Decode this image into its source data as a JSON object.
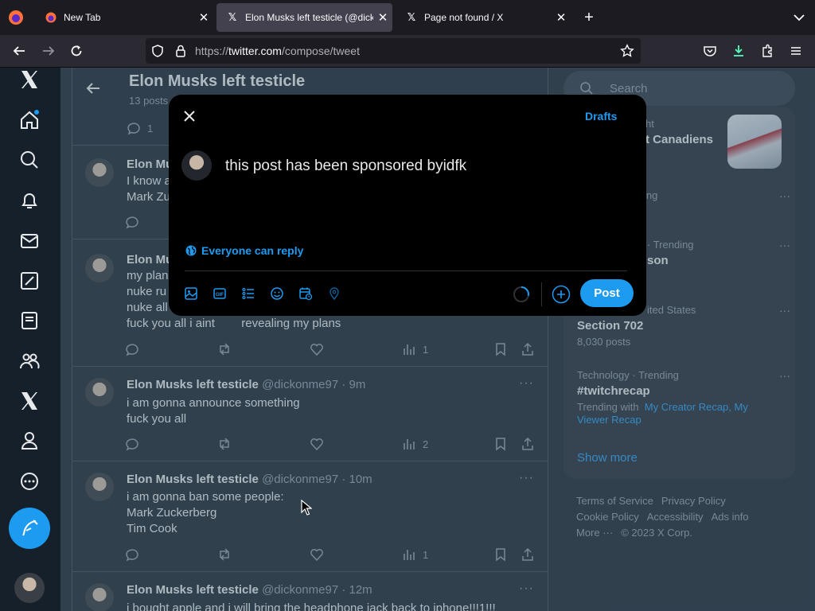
{
  "browser": {
    "tabs": [
      {
        "label": "New Tab",
        "icon": "firefox-icon"
      },
      {
        "label": "Elon Musks left testicle (@dicko",
        "icon": "x-logo-icon",
        "active": true
      },
      {
        "label": "Page not found / X",
        "icon": "x-logo-icon"
      }
    ],
    "url_prefix": "https://",
    "url_host": "twitter.com",
    "url_path": "/compose/tweet"
  },
  "profile_header": {
    "name": "Elon Musks left testicle",
    "posts_count": "13 posts"
  },
  "timeline": {
    "top_reply_count": "1",
    "posts": [
      {
        "name": "Elon Mu",
        "handle": "",
        "time": "",
        "text": "I know a\nMark Zu",
        "replies": "",
        "views": ""
      },
      {
        "name": "Elon Mu",
        "handle": "",
        "time": "",
        "text": "my plan\nnuke ru\nnuke all\nfuck you all i aint        revealing my plans",
        "replies": "",
        "views": "1"
      },
      {
        "name": "Elon Musks left testicle",
        "handle": "@dickonme97 · 9m",
        "text": "i am gonna announce something\nfuck you all",
        "views": "2"
      },
      {
        "name": "Elon Musks left testicle",
        "handle": "@dickonme97 · 10m",
        "text": "i am gonna ban some people:\nMark Zuckerberg\nTim Cook",
        "views": "1"
      },
      {
        "name": "Elon Musks left testicle",
        "handle": "@dickonme97 · 12m",
        "text": "i bought apple and i will bring the headphone jack back to iphone!!!1!!!",
        "views": ""
      }
    ]
  },
  "right": {
    "search_placeholder": "Search",
    "trends": [
      {
        "meta": "ht",
        "title": "t Canadiens",
        "count": ""
      },
      {
        "meta": "ing",
        "title": "",
        "count": ""
      },
      {
        "meta": "· Trending",
        "title": "son",
        "count": ""
      },
      {
        "meta": "ited States",
        "title": "Section 702",
        "count": "8,030 posts"
      },
      {
        "meta": "Technology · Trending",
        "title": "#twitchrecap",
        "count": ""
      }
    ],
    "trend5_with_prefix": "Trending with",
    "trend5_link1": "My Creator Recap, My",
    "trend5_link2": "Viewer Recap",
    "show_more": "Show more",
    "footer": {
      "terms": "Terms of Service",
      "privacy": "Privacy Policy",
      "cookie": "Cookie Policy",
      "accessibility": "Accessibility",
      "ads": "Ads info",
      "more": "More ···",
      "copyright": "© 2023 X Corp."
    }
  },
  "compose": {
    "drafts_label": "Drafts",
    "text": "this post has been sponsored byidfk",
    "reply_setting": "Everyone can reply",
    "post_label": "Post"
  },
  "colors": {
    "accent": "#1d9bf0",
    "bg": "#15202b",
    "modal_bg": "#000000"
  }
}
